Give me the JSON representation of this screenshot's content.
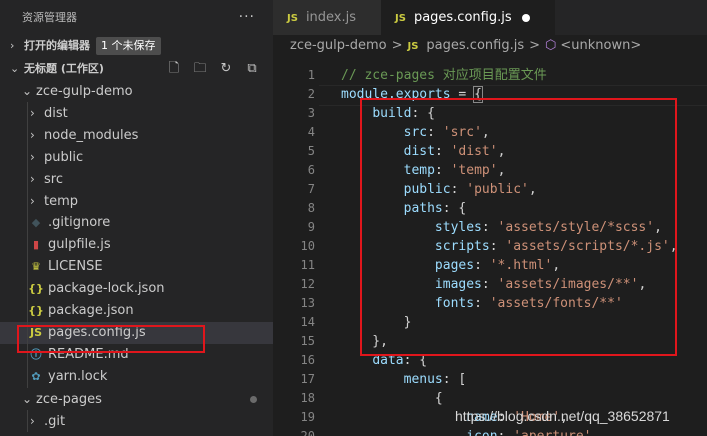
{
  "explorer": {
    "title": "资源管理器",
    "more": "···",
    "open_editors": {
      "label": "打开的编辑器",
      "badge": "1 个未保存"
    },
    "workspace": {
      "label": "无标题 (工作区)"
    },
    "tree": [
      {
        "label": "zce-gulp-demo",
        "type": "root-open"
      },
      {
        "label": "dist",
        "type": "folder"
      },
      {
        "label": "node_modules",
        "type": "folder"
      },
      {
        "label": "public",
        "type": "folder"
      },
      {
        "label": "src",
        "type": "folder"
      },
      {
        "label": "temp",
        "type": "folder"
      },
      {
        "label": ".gitignore",
        "type": "git"
      },
      {
        "label": "gulpfile.js",
        "type": "gulp"
      },
      {
        "label": "LICENSE",
        "type": "license"
      },
      {
        "label": "package-lock.json",
        "type": "json"
      },
      {
        "label": "package.json",
        "type": "json"
      },
      {
        "label": "pages.config.js",
        "type": "js"
      },
      {
        "label": "README.md",
        "type": "md"
      },
      {
        "label": "yarn.lock",
        "type": "yarn"
      },
      {
        "label": "zce-pages",
        "type": "root-open"
      },
      {
        "label": ".git",
        "type": "folder"
      }
    ]
  },
  "tabs": [
    {
      "icon": "JS",
      "label": "index.js",
      "active": false
    },
    {
      "icon": "JS",
      "label": "pages.config.js",
      "active": true
    }
  ],
  "breadcrumb": {
    "root": "zce-gulp-demo",
    "file": "pages.config.js",
    "symbol": "<unknown>",
    "sep": ">"
  },
  "code_lines": [
    {
      "n": "1",
      "t": "// zce-pages 对应项目配置文件"
    },
    {
      "n": "2",
      "t": "module.exports = {"
    },
    {
      "n": "3",
      "t": "    build: {"
    },
    {
      "n": "4",
      "t": "        src: 'src',"
    },
    {
      "n": "5",
      "t": "        dist: 'dist',"
    },
    {
      "n": "6",
      "t": "        temp: 'temp',"
    },
    {
      "n": "7",
      "t": "        public: 'public',"
    },
    {
      "n": "8",
      "t": "        paths: {"
    },
    {
      "n": "9",
      "t": "            styles: 'assets/style/*scss',"
    },
    {
      "n": "10",
      "t": "            scripts: 'assets/scripts/*.js',"
    },
    {
      "n": "11",
      "t": "            pages: '*.html',"
    },
    {
      "n": "12",
      "t": "            images: 'assets/images/**',"
    },
    {
      "n": "13",
      "t": "            fonts: 'assets/fonts/**'"
    },
    {
      "n": "14",
      "t": "        }"
    },
    {
      "n": "15",
      "t": "    },"
    },
    {
      "n": "16",
      "t": "    data: {"
    },
    {
      "n": "17",
      "t": "        menus: ["
    },
    {
      "n": "18",
      "t": "            {"
    },
    {
      "n": "19",
      "t": "                name: 'Home',"
    },
    {
      "n": "20",
      "t": "                icon: 'aperture',"
    }
  ],
  "watermark": "https://blog.csdn.net/qq_38652871",
  "colors": {
    "highlight_box": "#e0161c",
    "js_icon": "#cbcb41"
  }
}
